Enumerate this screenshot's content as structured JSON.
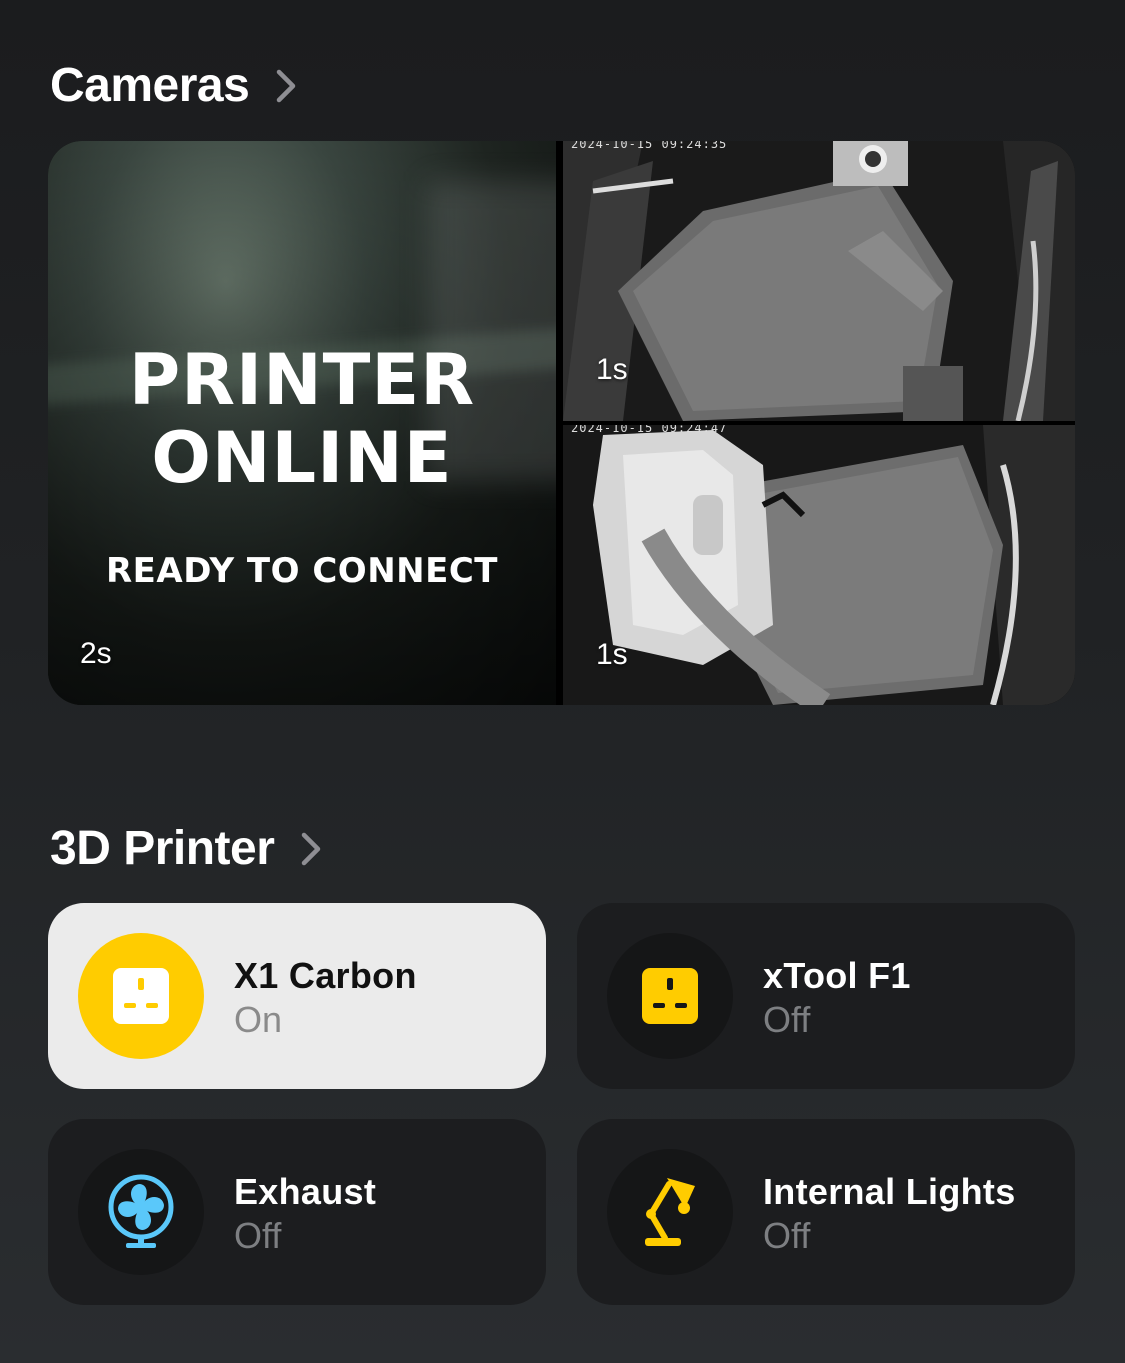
{
  "cameras": {
    "title": "Cameras",
    "main_feed": {
      "line1": "PRINTER",
      "line2": "ONLINE",
      "subtitle": "READY TO CONNECT",
      "age": "2s"
    },
    "feed2": {
      "timestamp": "2024-10-15 09:24:35",
      "age": "1s"
    },
    "feed3": {
      "timestamp": "2024-10-15 09:24:47",
      "age": "1s"
    }
  },
  "printer_section": {
    "title": "3D Printer",
    "accessories": [
      {
        "name": "X1 Carbon",
        "state": "On",
        "icon": "outlet-icon"
      },
      {
        "name": "xTool F1",
        "state": "Off",
        "icon": "outlet-icon"
      },
      {
        "name": "Exhaust",
        "state": "Off",
        "icon": "fan-icon"
      },
      {
        "name": "Internal Lights",
        "state": "Off",
        "icon": "lamp-icon"
      }
    ]
  },
  "colors": {
    "accent_yellow": "#ffcc00",
    "fan_blue": "#5ac8fa",
    "tile_on_bg": "#ebebeb",
    "tile_off_bg": "#1c1d1f"
  }
}
